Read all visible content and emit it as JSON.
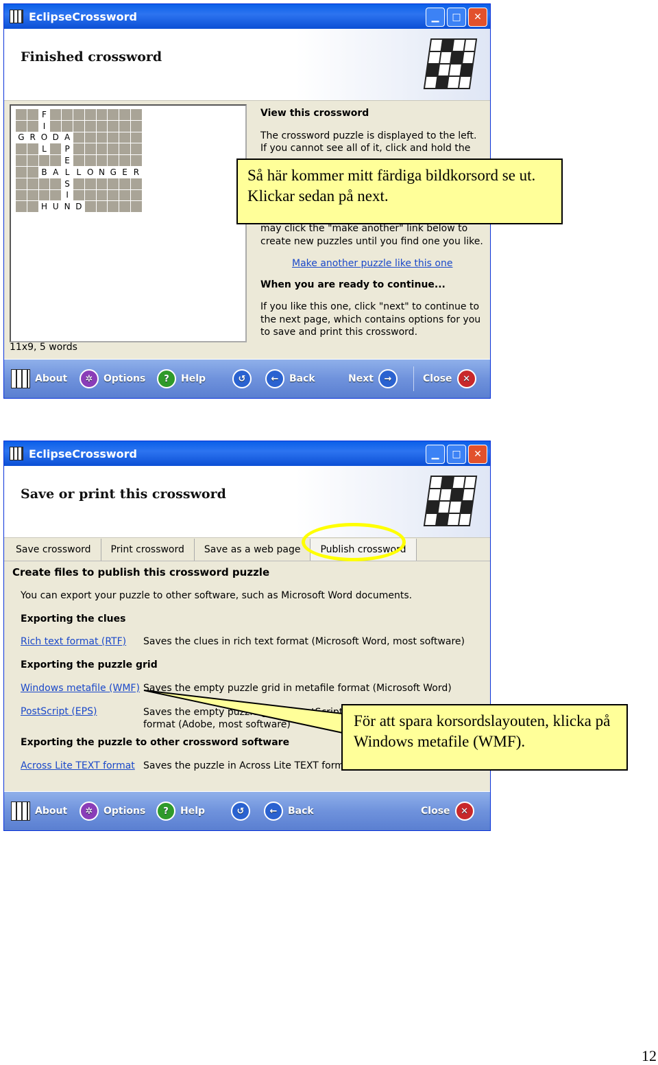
{
  "window1": {
    "title": "EclipseCrossword",
    "header": "Finished crossword",
    "grid": [
      [
        "",
        "",
        "F",
        "",
        "",
        "",
        "",
        "",
        "",
        "",
        ""
      ],
      [
        "",
        "",
        "I",
        "",
        "",
        "",
        "",
        "",
        "",
        "",
        ""
      ],
      [
        "G",
        "R",
        "O",
        "D",
        "A",
        "",
        "",
        "",
        "",
        "",
        ""
      ],
      [
        "",
        "",
        "L",
        "",
        "P",
        "",
        "",
        "",
        "",
        "",
        ""
      ],
      [
        "",
        "",
        "",
        "",
        "E",
        "",
        "",
        "",
        "",
        "",
        ""
      ],
      [
        "",
        "",
        "B",
        "A",
        "L",
        "L",
        "O",
        "N",
        "G",
        "E",
        "R"
      ],
      [
        "",
        "",
        "",
        "",
        "S",
        "",
        "",
        "",
        "",
        "",
        ""
      ],
      [
        "",
        "",
        "",
        "",
        "I",
        "",
        "",
        "",
        "",
        "",
        ""
      ],
      [
        "",
        "",
        "H",
        "U",
        "N",
        "D",
        "",
        "",
        "",
        "",
        ""
      ]
    ],
    "grid_info": "11x9, 5 words",
    "view_heading": "View this crossword",
    "view_lines": [
      "The crossword puzzle is displayed to the left.",
      "If you cannot see all of it, click and hold the"
    ],
    "view_lines2": [
      "may click the \"make another\" link below to",
      "create new puzzles until you find one you like."
    ],
    "make_another_link": "Make another puzzle like this one",
    "continue_heading": "When you are ready to continue...",
    "continue_text": "If you like this one, click \"next\" to continue to the next page, which contains options for you to save and print this crossword.",
    "toolbar": {
      "about": "About",
      "options": "Options",
      "help": "Help",
      "back": "Back",
      "next": "Next",
      "close": "Close"
    }
  },
  "callout1": "Så här kommer mitt färdiga bildkorsord se ut. Klickar sedan på next.",
  "window2": {
    "title": "EclipseCrossword",
    "header": "Save or print this crossword",
    "tabs": [
      "Save crossword",
      "Print crossword",
      "Save as a web page",
      "Publish crossword"
    ],
    "heading": "Create files to publish this crossword puzzle",
    "intro": "You can export your puzzle to other software, such as Microsoft Word documents.",
    "clues_heading": "Exporting the clues",
    "rtf_link": "Rich text format (RTF)",
    "rtf_desc": "Saves the clues in rich text format (Microsoft Word, most software)",
    "grid_heading": "Exporting the puzzle grid",
    "wmf_link": "Windows metafile (WMF)",
    "wmf_desc": "Saves the empty puzzle grid in metafile format (Microsoft Word)",
    "eps_link": "PostScript (EPS)",
    "eps_desc": "Saves the empty puzzle grid in PostScript format (Adobe, most software)",
    "other_heading": "Exporting the puzzle to other crossword software",
    "across_link": "Across Lite TEXT format",
    "across_desc": "Saves the puzzle in Across Lite TEXT format",
    "toolbar": {
      "about": "About",
      "options": "Options",
      "help": "Help",
      "back": "Back",
      "close": "Close"
    }
  },
  "callout2": "För att spara korsordslayouten, klicka på Windows metafile (WMF).",
  "highlight_color": "#ffff00",
  "page_number": "12"
}
